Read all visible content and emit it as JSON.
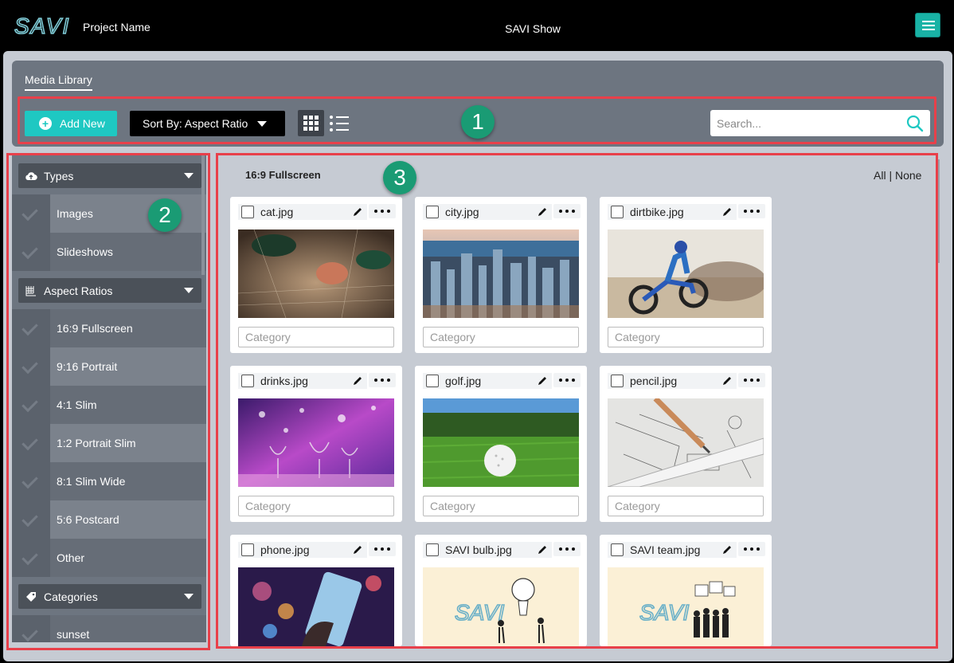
{
  "header": {
    "logo_text": "SAVI",
    "project_name": "Project Name",
    "show_name": "SAVI Show",
    "menu_icon": "hamburger-icon"
  },
  "library": {
    "title": "Media Library",
    "add_new_label": "Add New",
    "sort_label": "Sort By: Aspect Ratio",
    "search_placeholder": "Search...",
    "view_modes": [
      "grid-view-icon",
      "list-view-icon"
    ]
  },
  "badges": [
    "1",
    "2",
    "3"
  ],
  "colors": {
    "accent": "#1ec8c2",
    "highlight": "#e8404a",
    "badge": "#1a9b74"
  },
  "sidebar": {
    "types": {
      "label": "Types",
      "icon": "cloud-upload-icon",
      "items": [
        {
          "label": "Images"
        },
        {
          "label": "Slideshows"
        }
      ]
    },
    "aspect_ratios": {
      "label": "Aspect Ratios",
      "icon": "aspect-grid-icon",
      "items": [
        {
          "label": "16:9 Fullscreen"
        },
        {
          "label": "9:16 Portrait"
        },
        {
          "label": "4:1 Slim"
        },
        {
          "label": "1:2 Portrait Slim"
        },
        {
          "label": "8:1 Slim Wide"
        },
        {
          "label": "5:6 Postcard"
        },
        {
          "label": "Other"
        }
      ]
    },
    "categories": {
      "label": "Categories",
      "icon": "tag-icon",
      "items": [
        {
          "label": "sunset"
        }
      ]
    }
  },
  "main": {
    "group_title": "16:9 Fullscreen",
    "select_all_none": "All | None",
    "category_placeholder": "Category",
    "media": [
      {
        "name": "cat.jpg"
      },
      {
        "name": "city.jpg"
      },
      {
        "name": "dirtbike.jpg"
      },
      {
        "name": "drinks.jpg"
      },
      {
        "name": "golf.jpg"
      },
      {
        "name": "pencil.jpg"
      },
      {
        "name": "phone.jpg"
      },
      {
        "name": "SAVI bulb.jpg"
      },
      {
        "name": "SAVI team.jpg"
      }
    ]
  }
}
